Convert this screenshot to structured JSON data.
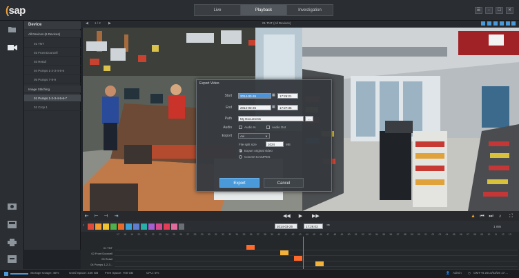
{
  "app": {
    "logo_text": "sap"
  },
  "nav": {
    "tabs": [
      "Live",
      "Playback",
      "Investigation"
    ],
    "active": "Playback"
  },
  "window_controls": [
    "☰",
    "–",
    "☐",
    "✕"
  ],
  "device_panel": {
    "header": "Device",
    "group1": "All Devices (6 Devices)",
    "devices": [
      "01 TNT",
      "02 Front Doorcell",
      "03 Retail",
      "04 Pumps 1-2-3-4-5-6",
      "05 Pumps 7-8-9"
    ],
    "group2": "Image Stitching",
    "stitched": [
      "01 Pumps 1-2-3-4-5-6-7",
      "01 Crop 1"
    ]
  },
  "video": {
    "title": "01 TNT (All Devices)",
    "pager": "1 / 2"
  },
  "dialog": {
    "title": "Export Video",
    "start_label": "Start",
    "start_date": "2014-03-26",
    "start_time": "17:26:21",
    "end_label": "End",
    "end_date": "2014-03-26",
    "end_time": "17:27:35",
    "path_label": "Path",
    "path_value": "My Documents",
    "path_button": "...",
    "audio_label": "Audio",
    "audio_in": "Audio In",
    "audio_out": "Audio Out",
    "export_label": "Export",
    "export_value": "Avi",
    "split_label": "File split size",
    "split_value": "1024",
    "split_unit": "MB",
    "opt_original": "Export original video",
    "opt_convert": "Convert to MJPEG",
    "export_button": "Export",
    "cancel_button": "Cancel"
  },
  "timeline": {
    "date": "2014-03-26",
    "time": "17:26:03",
    "zoom": "1 min",
    "rows": [
      "01 TNT",
      "02 Front Doorcell",
      "03 Retail",
      "04 Pumps 1-2-3..."
    ],
    "ticks": [
      "17",
      "18",
      "19",
      "20",
      "21",
      "22",
      "23",
      "24",
      "25",
      "26",
      "27",
      "28",
      "29",
      "30",
      "31",
      "32",
      "33",
      "34",
      "35",
      "36",
      "37",
      "38",
      "39",
      "40",
      "41",
      "42",
      "43",
      "44",
      "45",
      "46",
      "47",
      "48",
      "49",
      "50",
      "51",
      "52",
      "53",
      "54",
      "55",
      "56",
      "57",
      "58",
      "59",
      "00",
      "01",
      "02",
      "03",
      "04",
      "05",
      "06",
      "07",
      "08",
      "09",
      "10",
      "11",
      "12",
      "13"
    ]
  },
  "status": {
    "storage": "Storage Usage: 45%",
    "used": "Used Space: 230 GB",
    "free": "Free Space: 700 GB",
    "cpu": "CPU: 5%",
    "user": "Admin",
    "clock": "GMT+8 2014/03/26 17:..."
  },
  "colors": {
    "accent": "#4a9ad9",
    "orange": "#ff6a2a",
    "yellow": "#f4b23a"
  }
}
